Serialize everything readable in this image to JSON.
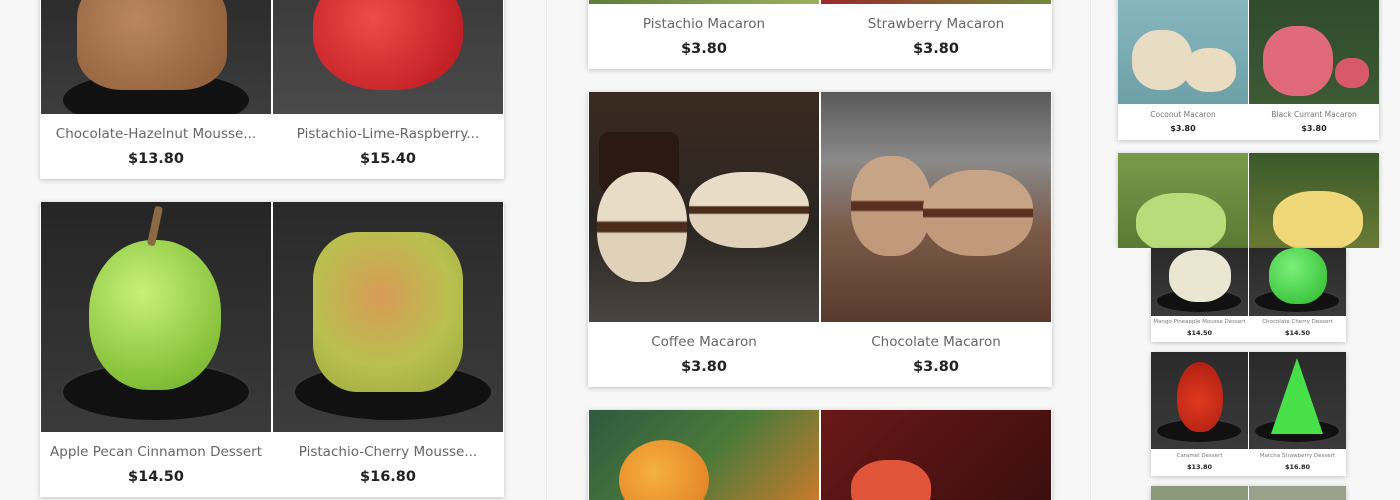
{
  "left_panel": {
    "products": [
      {
        "name": "Chocolate-Hazelnut Mousse...",
        "price": "$13.80"
      },
      {
        "name": "Pistachio-Lime-Raspberry...",
        "price": "$15.40"
      },
      {
        "name": "Apple Pecan Cinnamon Dessert",
        "price": "$14.50"
      },
      {
        "name": "Pistachio-Cherry Mousse...",
        "price": "$16.80"
      }
    ]
  },
  "middle_panel": {
    "products": [
      {
        "name": "Pistachio Macaron",
        "price": "$3.80"
      },
      {
        "name": "Strawberry Macaron",
        "price": "$3.80"
      },
      {
        "name": "Coffee Macaron",
        "price": "$3.80"
      },
      {
        "name": "Chocolate Macaron",
        "price": "$3.80"
      }
    ]
  },
  "right_panel": {
    "macarons": [
      {
        "name": "Coconut Macaron",
        "price": "$3.80"
      },
      {
        "name": "Black Currant Macaron",
        "price": "$3.80"
      }
    ],
    "desserts": [
      {
        "name": "Mango Pineapple Mousse Dessert",
        "price": "$14.50"
      },
      {
        "name": "Chocolate Cherry Dessert",
        "price": "$14.50"
      },
      {
        "name": "Caramel Dessert",
        "price": "$13.80"
      },
      {
        "name": "Matcha Strawberry Dessert",
        "price": "$16.80"
      }
    ]
  },
  "colors": {
    "panel_bg": "#f7f7f7",
    "card_bg": "#ffffff",
    "name_text": "#666666",
    "price_text": "#222222"
  }
}
